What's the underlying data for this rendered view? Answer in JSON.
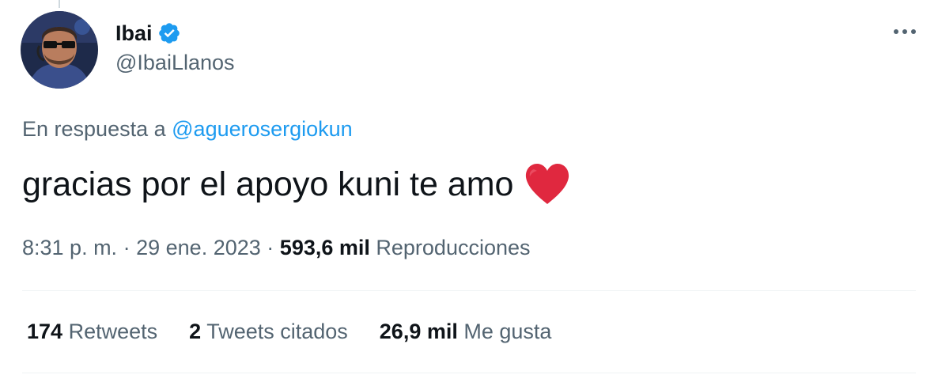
{
  "author": {
    "display_name": "Ibai",
    "handle": "@IbaiLlanos",
    "verified": true,
    "avatar_icon": "user-avatar-photo"
  },
  "colors": {
    "text_primary": "#0f1419",
    "text_secondary": "#536471",
    "accent": "#1d9bf0",
    "heart": "#e0283f",
    "divider": "#eff3f4"
  },
  "tweet": {
    "reply_prefix": "En respuesta a",
    "reply_to": "@aguerosergiokun",
    "text": "gracias por el apoyo kuni te amo",
    "emoji": "red-heart-emoji",
    "time": "8:31 p. m.",
    "separator": "·",
    "date": "29 ene. 2023",
    "views_count": "593,6 mil",
    "views_label": "Reproducciones"
  },
  "stats": [
    {
      "count": "174",
      "label": "Retweets"
    },
    {
      "count": "2",
      "label": "Tweets citados"
    },
    {
      "count": "26,9 mil",
      "label": "Me gusta"
    }
  ],
  "icons": {
    "more": "more-options-icon",
    "verified": "verified-badge-icon"
  }
}
